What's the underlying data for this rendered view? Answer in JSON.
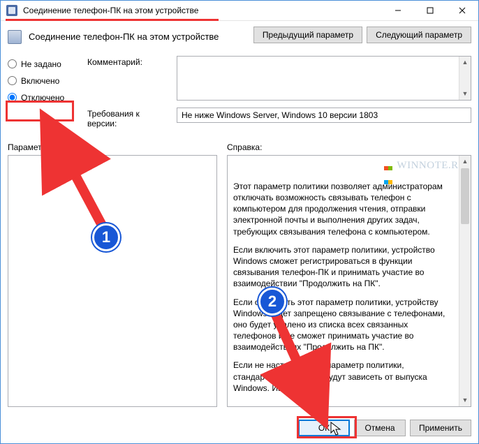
{
  "titlebar": {
    "title": "Соединение телефон-ПК на этом устройстве"
  },
  "header": {
    "title": "Соединение телефон-ПК на этом устройстве"
  },
  "nav": {
    "prev": "Предыдущий параметр",
    "next": "Следующий параметр"
  },
  "radios": {
    "not_configured": "Не задано",
    "enabled": "Включено",
    "disabled": "Отключено",
    "selected": "disabled"
  },
  "labels": {
    "comment": "Комментарий:",
    "version_req": "Требования к версии:",
    "version_value": "Не ниже Windows Server, Windows 10 версии 1803",
    "params": "Параметры:",
    "help": "Справка:"
  },
  "help": {
    "p1": "Этот параметр политики позволяет администраторам отключать возможность связывать телефон с компьютером для продолжения чтения, отправки электронной почты и выполнения других задач, требующих связывания телефона с компьютером.",
    "p2": "Если включить этот параметр политики, устройство Windows сможет регистрироваться в функции связывания телефон-ПК и принимать участие во взаимодействии \"Продолжить на ПК\".",
    "p3": "Если отключить этот параметр политики, устройству Windows будет запрещено связывание с телефонами, оно будет удалено из списка всех связанных телефонов и не сможет принимать участие во взаимодействиях \"Продолжить на ПК\".",
    "p4": "Если не настроить этот параметр политики, стандартные действия будут зависеть от выпуска Windows. Изменения"
  },
  "footer": {
    "ok": "ОК",
    "cancel": "Отмена",
    "apply": "Применить"
  },
  "watermark": "WINNOTE.RU",
  "annotation": {
    "badge1": "1",
    "badge2": "2"
  }
}
